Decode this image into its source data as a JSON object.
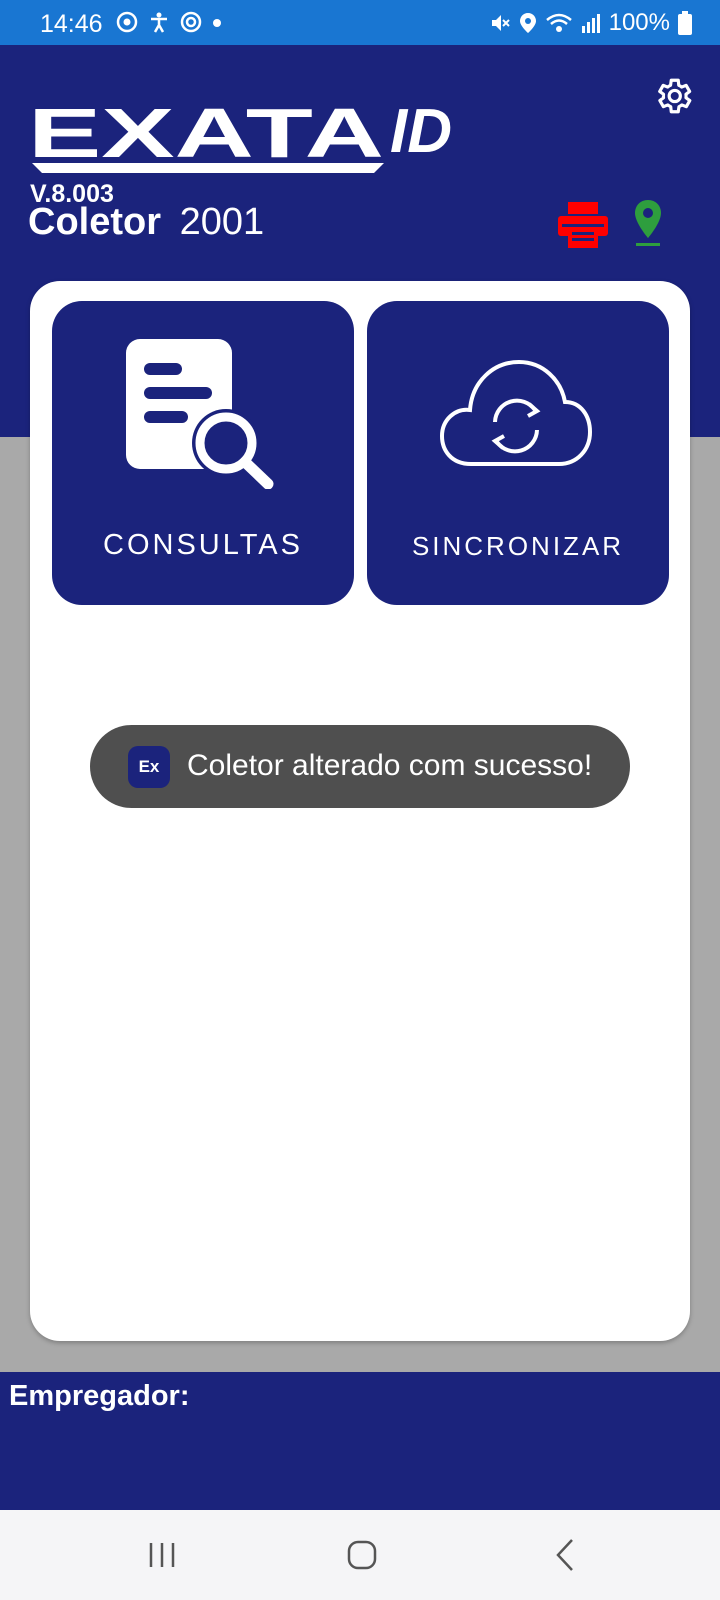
{
  "status_bar": {
    "time": "14:46",
    "battery_pct": "100%",
    "left_icons": [
      "sync-icon",
      "accessibility-icon",
      "dnd-icon",
      "dot-icon"
    ],
    "right_icons": [
      "mute-icon",
      "location-icon",
      "wifi-icon",
      "signal-icon",
      "battery-icon"
    ]
  },
  "header": {
    "logo_text": "EXATA",
    "logo_suffix": "ID",
    "version": "V.8.003",
    "coletor_label": "Coletor",
    "coletor_value": "2001",
    "printer_color": "#ff0000",
    "location_color": "#2e9e3e"
  },
  "tiles": [
    {
      "label": "CONSULTAS",
      "icon": "document-search-icon"
    },
    {
      "label": "SINCRONIZAR",
      "icon": "cloud-sync-icon"
    }
  ],
  "toast": {
    "icon_text": "Ex",
    "message": "Coletor alterado com sucesso!"
  },
  "footer": {
    "label": "Empregador:"
  },
  "colors": {
    "primary": "#1b237c",
    "status_bar": "#1976d2",
    "background": "#a9a9a9"
  }
}
